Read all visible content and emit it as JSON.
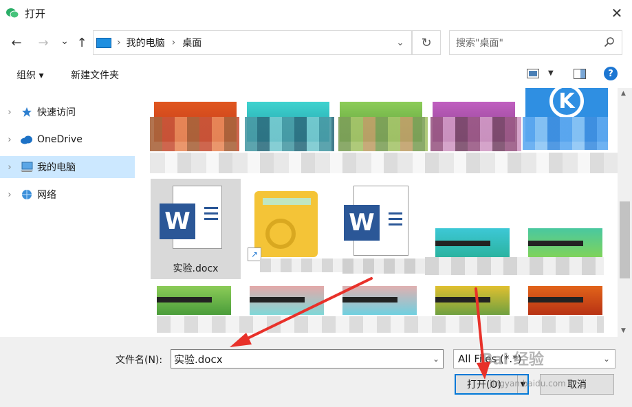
{
  "window": {
    "title": "打开",
    "close_glyph": "✕"
  },
  "nav": {
    "back": "←",
    "forward": "→",
    "recent": "⌄",
    "up": "↑",
    "breadcrumb": [
      "我的电脑",
      "桌面"
    ],
    "separator": "›",
    "dropdown": "⌄",
    "refresh": "↻",
    "search_placeholder": "搜索\"桌面\""
  },
  "toolbar": {
    "organize": "组织 ▾",
    "new_folder": "新建文件夹",
    "help": "?"
  },
  "sidebar": {
    "items": [
      {
        "label": "快速访问",
        "icon": "star-icon"
      },
      {
        "label": "OneDrive",
        "icon": "cloud-icon"
      },
      {
        "label": "我的电脑",
        "icon": "computer-icon",
        "selected": true
      },
      {
        "label": "网络",
        "icon": "network-icon"
      }
    ]
  },
  "files": {
    "selected_label": "实验.docx"
  },
  "footer": {
    "filename_label": "文件名(N):",
    "filename_value": "实验.docx",
    "filter_value": "All Files (*.*)",
    "open_label": "打开(O)",
    "cancel_label": "取消"
  },
  "watermark": {
    "text": "Bai 经验",
    "sub": "jingyan.baidu.com"
  },
  "colors": {
    "selection": "#cce8ff",
    "accent": "#0078d7",
    "annotation": "#e8312a",
    "word_blue": "#2b5797",
    "folder_yellow": "#f4c437"
  }
}
